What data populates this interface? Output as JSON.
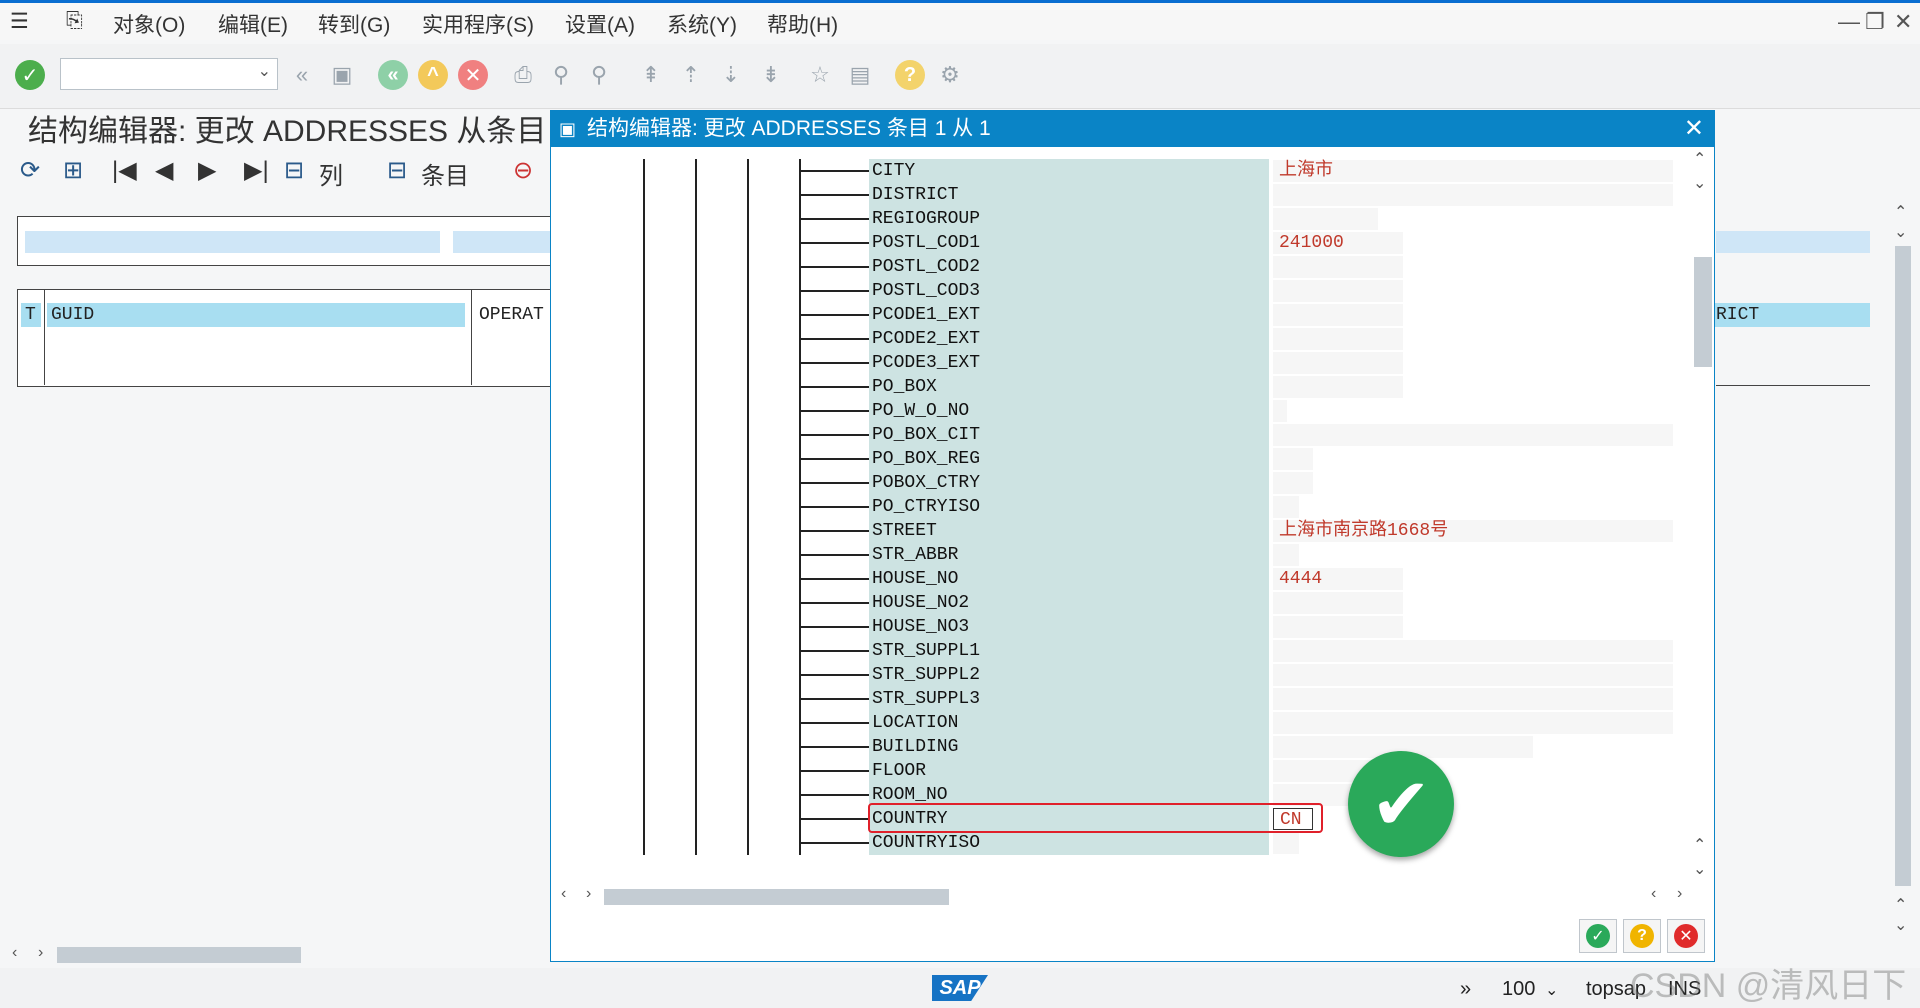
{
  "menubar": {
    "items": [
      "对象(O)",
      "编辑(E)",
      "转到(G)",
      "实用程序(S)",
      "设置(A)",
      "系统(Y)",
      "帮助(H)"
    ]
  },
  "toolbar": {
    "command_value": ""
  },
  "page": {
    "title": "结构编辑器: 更改 ADDRESSES 从条目",
    "app_toolbar": {
      "columns_label": "列",
      "entries_label": "条目"
    },
    "table_header": {
      "col_t": "T",
      "col_guid": "GUID",
      "col_operat": "OPERAT",
      "col_district": "RICT"
    }
  },
  "dialog": {
    "title": "结构编辑器: 更改 ADDRESSES 条目 1 从 1",
    "fields": [
      {
        "name": "CITY",
        "value": "上海市"
      },
      {
        "name": "DISTRICT",
        "value": ""
      },
      {
        "name": "REGIOGROUP",
        "value": ""
      },
      {
        "name": "POSTL_COD1",
        "value": "241000"
      },
      {
        "name": "POSTL_COD2",
        "value": ""
      },
      {
        "name": "POSTL_COD3",
        "value": ""
      },
      {
        "name": "PCODE1_EXT",
        "value": ""
      },
      {
        "name": "PCODE2_EXT",
        "value": ""
      },
      {
        "name": "PCODE3_EXT",
        "value": ""
      },
      {
        "name": "PO_BOX",
        "value": ""
      },
      {
        "name": "PO_W_O_NO",
        "value": ""
      },
      {
        "name": "PO_BOX_CIT",
        "value": ""
      },
      {
        "name": "PO_BOX_REG",
        "value": ""
      },
      {
        "name": "POBOX_CTRY",
        "value": ""
      },
      {
        "name": "PO_CTRYISO",
        "value": ""
      },
      {
        "name": "STREET",
        "value": "上海市南京路1668号"
      },
      {
        "name": "STR_ABBR",
        "value": ""
      },
      {
        "name": "HOUSE_NO",
        "value": "4444"
      },
      {
        "name": "HOUSE_NO2",
        "value": ""
      },
      {
        "name": "HOUSE_NO3",
        "value": ""
      },
      {
        "name": "STR_SUPPL1",
        "value": ""
      },
      {
        "name": "STR_SUPPL2",
        "value": ""
      },
      {
        "name": "STR_SUPPL3",
        "value": ""
      },
      {
        "name": "LOCATION",
        "value": ""
      },
      {
        "name": "BUILDING",
        "value": ""
      },
      {
        "name": "FLOOR",
        "value": ""
      },
      {
        "name": "ROOM_NO",
        "value": ""
      },
      {
        "name": "COUNTRY",
        "value": "CN"
      },
      {
        "name": "COUNTRYISO",
        "value": ""
      }
    ]
  },
  "statusbar": {
    "logo": "SAP",
    "zoom": "100",
    "system": "topsap",
    "mode": "INS"
  },
  "watermark": "CSDN @清风日下",
  "colors": {
    "accent": "#0a84c6",
    "field_name_bg": "#cde3e2",
    "value_text": "#c0392b",
    "highlight": "#e0202a",
    "success": "#2aa95a"
  }
}
